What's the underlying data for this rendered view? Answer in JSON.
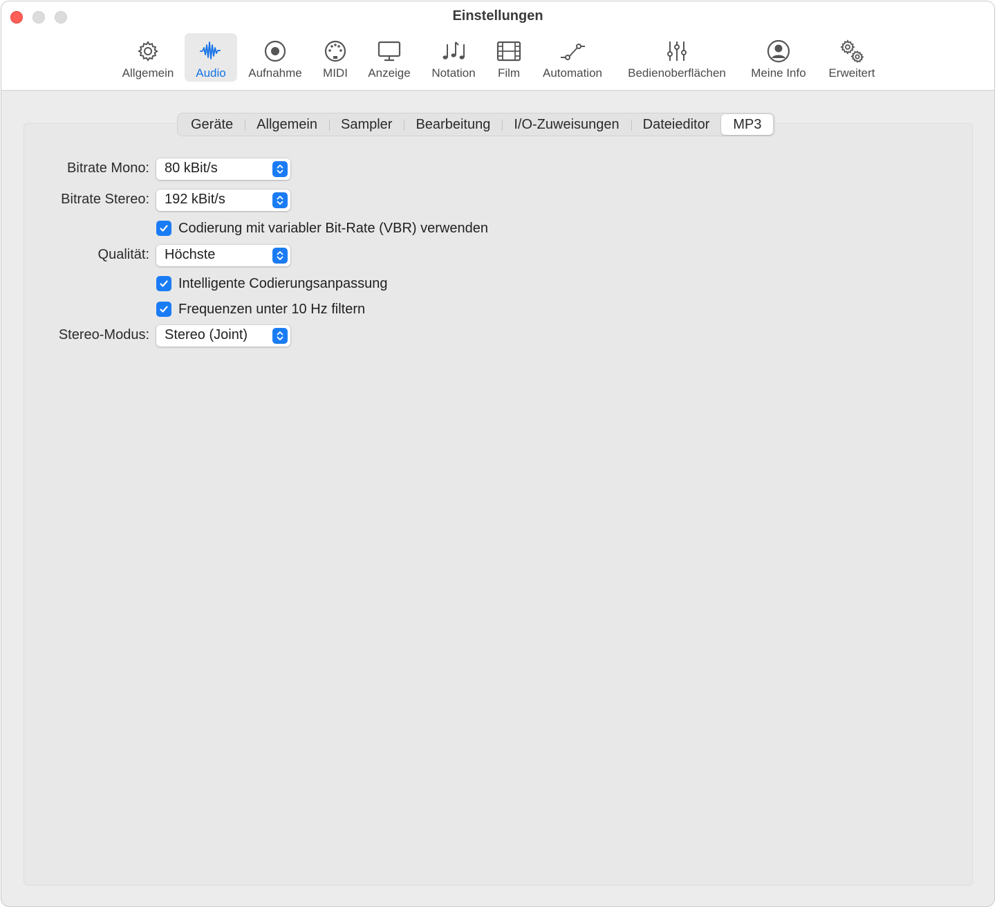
{
  "window": {
    "title": "Einstellungen"
  },
  "toolbar": {
    "items": [
      {
        "label": "Allgemein",
        "icon": "gear-icon"
      },
      {
        "label": "Audio",
        "icon": "waveform-icon",
        "selected": true
      },
      {
        "label": "Aufnahme",
        "icon": "record-icon"
      },
      {
        "label": "MIDI",
        "icon": "midi-plug-icon"
      },
      {
        "label": "Anzeige",
        "icon": "display-icon"
      },
      {
        "label": "Notation",
        "icon": "music-notes-icon"
      },
      {
        "label": "Film",
        "icon": "film-icon"
      },
      {
        "label": "Automation",
        "icon": "automation-icon"
      },
      {
        "label": "Bedienoberflächen",
        "icon": "sliders-icon"
      },
      {
        "label": "Meine Info",
        "icon": "person-icon"
      },
      {
        "label": "Erweitert",
        "icon": "gears-icon"
      }
    ]
  },
  "tabs": [
    {
      "label": "Geräte"
    },
    {
      "label": "Allgemein"
    },
    {
      "label": "Sampler"
    },
    {
      "label": "Bearbeitung"
    },
    {
      "label": "I/O-Zuweisungen"
    },
    {
      "label": "Dateieditor"
    },
    {
      "label": "MP3",
      "active": true
    }
  ],
  "mp3": {
    "bitrate_mono": {
      "label": "Bitrate Mono:",
      "value": "80 kBit/s"
    },
    "bitrate_stereo": {
      "label": "Bitrate Stereo:",
      "value": "192 kBit/s"
    },
    "vbr": {
      "label": "Codierung mit variabler Bit-Rate (VBR) verwenden",
      "checked": true
    },
    "quality": {
      "label": "Qualität:",
      "value": "Höchste"
    },
    "smart_encoding": {
      "label": "Intelligente Codierungsanpassung",
      "checked": true
    },
    "filter_10hz": {
      "label": "Frequenzen unter 10 Hz filtern",
      "checked": true
    },
    "stereo_mode": {
      "label": "Stereo-Modus:",
      "value": "Stereo (Joint)"
    }
  },
  "colors": {
    "accent": "#1a7cf5",
    "close": "#ff5f57"
  }
}
